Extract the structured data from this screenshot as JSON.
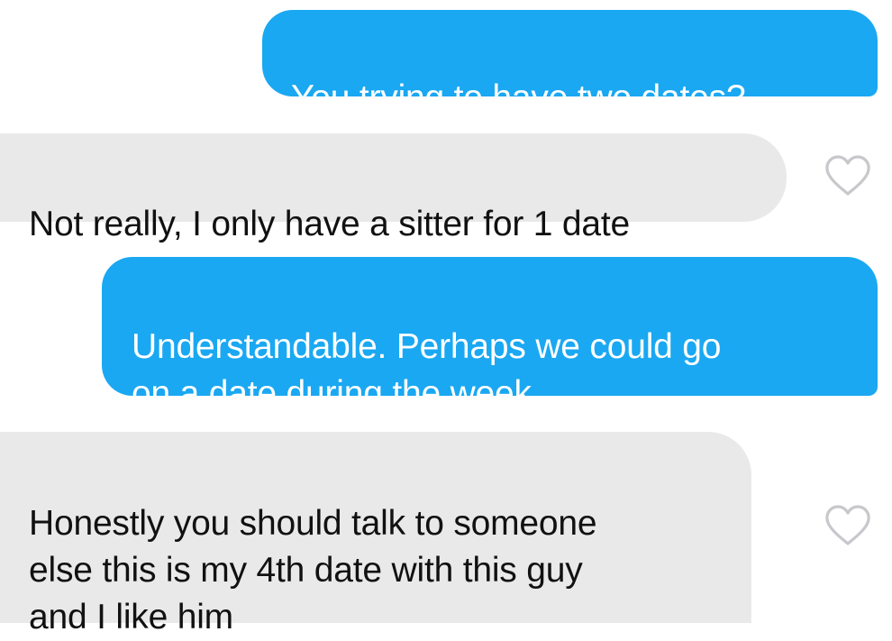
{
  "conversation": {
    "messages": [
      {
        "sender": "me",
        "text": "You trying to have two dates?"
      },
      {
        "sender": "them",
        "text": "Not really, I only have a sitter for 1 date",
        "reaction_icon": "heart-outline-icon"
      },
      {
        "sender": "me",
        "text": "Understandable. Perhaps we could go\non a date during the week"
      },
      {
        "sender": "them",
        "text": "Honestly you should talk to someone\nelse this is my 4th date with this guy\nand I like him",
        "reaction_icon": "heart-outline-icon"
      }
    ]
  },
  "colors": {
    "sent_bubble": "#1aa8f2",
    "received_bubble": "#e9e9ea",
    "heart_outline": "#c8c8cc"
  }
}
